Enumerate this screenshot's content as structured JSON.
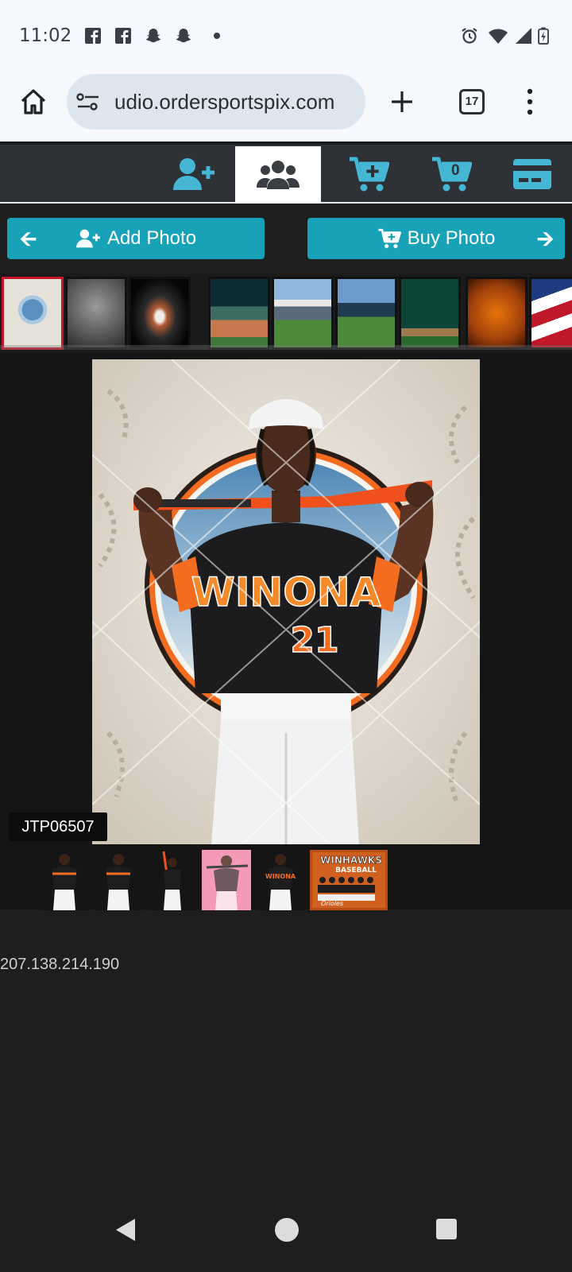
{
  "status_bar": {
    "time": "11:02",
    "notification_icons": [
      "facebook-icon",
      "facebook-icon",
      "snapchat-icon",
      "snapchat-icon",
      "dot-icon"
    ],
    "system_icons": [
      "alarm-icon",
      "wifi-icon",
      "signal-icon",
      "battery-icon"
    ]
  },
  "browser": {
    "url": "udio.ordersportspix.com",
    "tab_count": "17"
  },
  "app_nav": {
    "items": [
      "add-user-icon",
      "group-icon",
      "cart-plus-icon",
      "cart-icon",
      "credit-card-icon"
    ],
    "active_index": 1,
    "cart_count": "0"
  },
  "actions": {
    "add_photo": "Add Photo",
    "buy_photo": "Buy Photo"
  },
  "backgrounds": {
    "selected_index": 0,
    "count": 9
  },
  "photo": {
    "code": "JTP06507"
  },
  "photo_thumbs": {
    "count": 6
  },
  "footer": {
    "ip": "207.138.214.190"
  },
  "colors": {
    "accent": "#17a2b8",
    "nav_icon": "#45b6d3",
    "selected_border": "#c7162b",
    "jersey_orange": "#f26b21"
  }
}
